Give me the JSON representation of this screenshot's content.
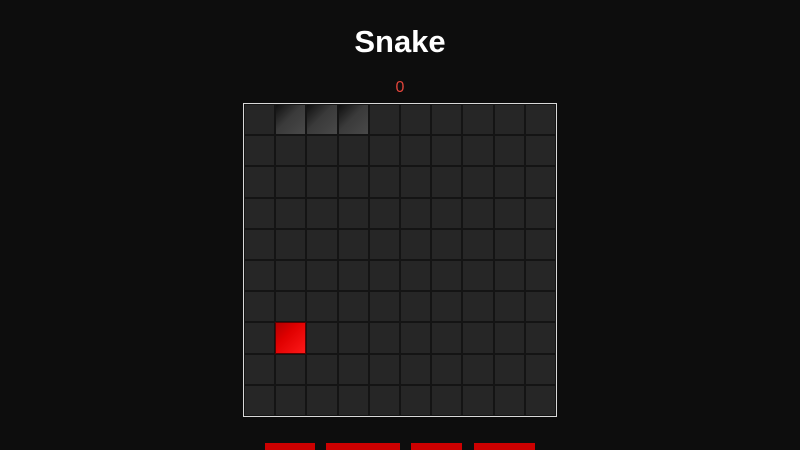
{
  "game": {
    "title": "Snake",
    "score": "0"
  },
  "board": {
    "columns": 10,
    "rows": 10,
    "snake": [
      [
        1,
        0
      ],
      [
        2,
        0
      ],
      [
        3,
        0
      ]
    ],
    "food": [
      1,
      7
    ]
  },
  "controls": {
    "buttons": [
      {
        "label": ""
      },
      {
        "label": ""
      },
      {
        "label": ""
      },
      {
        "label": ""
      }
    ]
  },
  "colors": {
    "background": "#0d0d0d",
    "score": "#e0443a",
    "food": "#e00000",
    "button": "#cc0000"
  }
}
